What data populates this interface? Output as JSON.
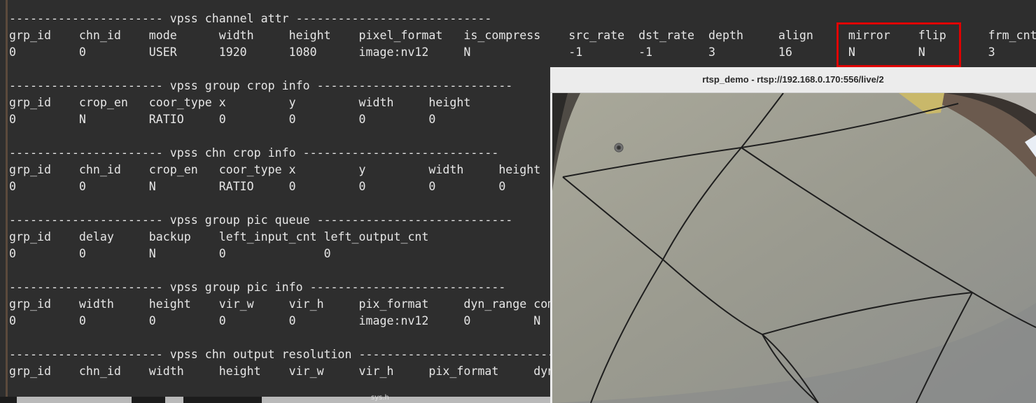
{
  "terminal": {
    "lines": [
      "---------------------- vpss channel attr ----------------------------",
      "grp_id    chn_id    mode      width     height    pixel_format   is_compress    src_rate  dst_rate  depth     align     mirror    flip      frm_cnt",
      "0         0         USER      1920      1080      image:nv12     N              -1        -1        3         16        N         N         3",
      "",
      "---------------------- vpss group crop info ----------------------------",
      "grp_id    crop_en   coor_type x         y         width     height",
      "0         N         RATIO     0         0         0         0",
      "",
      "---------------------- vpss chn crop info ----------------------------",
      "grp_id    chn_id    crop_en   coor_type x         y         width     height",
      "0         0         N         RATIO     0         0         0         0",
      "",
      "---------------------- vpss group pic queue ----------------------------",
      "grp_id    delay     backup    left_input_cnt left_output_cnt",
      "0         0         N         0              0",
      "",
      "---------------------- vpss group pic info ----------------------------",
      "grp_id    width     height    vir_w     vir_h     pix_format     dyn_range compress",
      "0         0         0         0         0         image:nv12     0         N",
      "",
      "---------------------- vpss chn output resolution ----------------------------",
      "grp_id    chn_id    width     height    vir_w     vir_h     pix_format     dyn_range"
    ]
  },
  "player": {
    "title": "rtsp_demo - rtsp://192.168.0.170:556/live/2"
  },
  "taskbar": {
    "tab_label": "sys.h"
  },
  "colors": {
    "terminal_bg": "#2e2e2e",
    "terminal_fg": "#e6e6e6",
    "highlight": "#e00000"
  }
}
